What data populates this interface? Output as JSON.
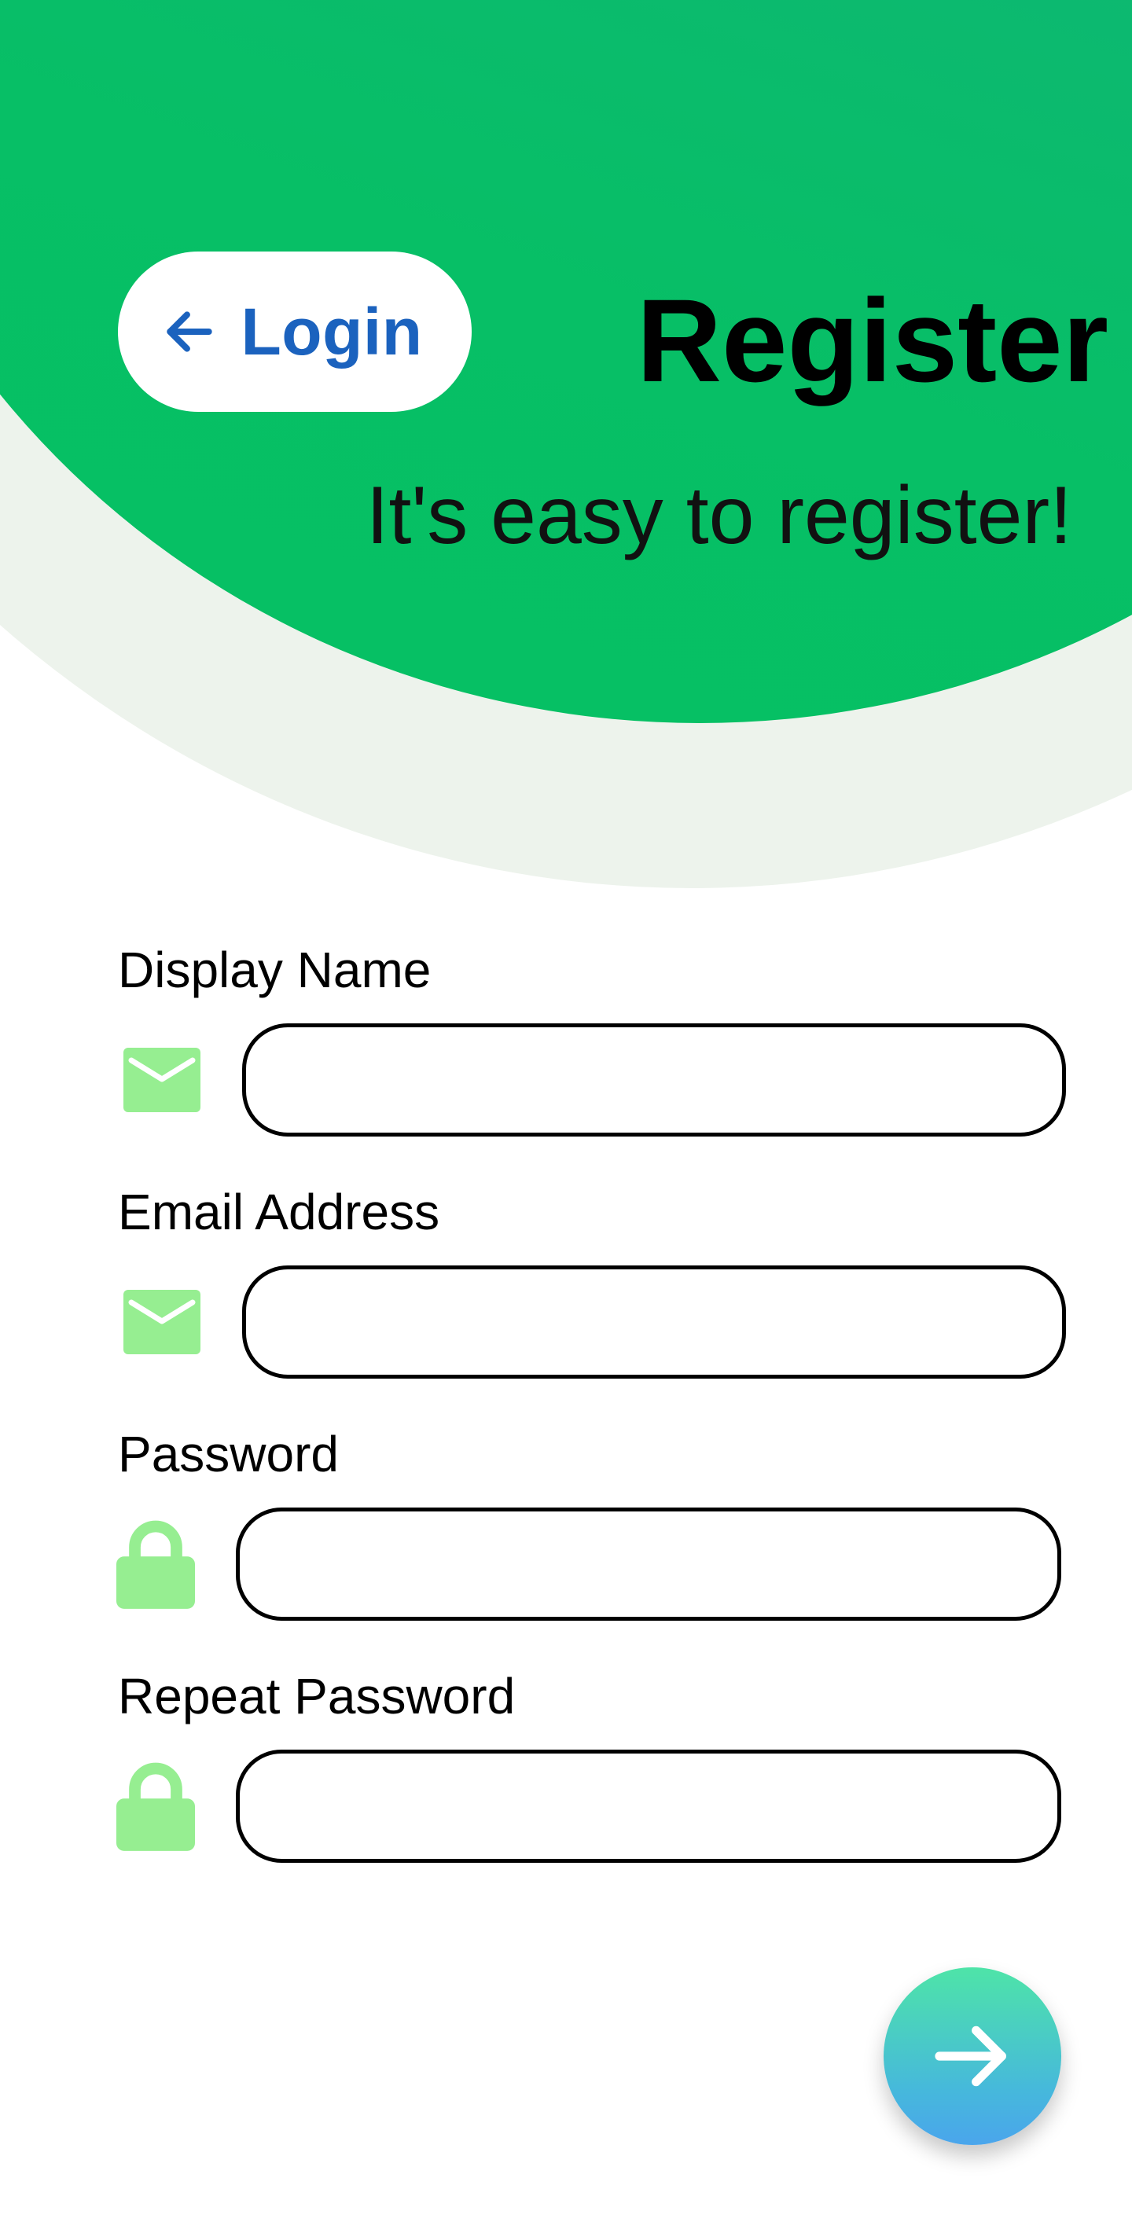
{
  "header": {
    "back_button": {
      "label": "Login",
      "icon": "arrow-left-icon"
    },
    "title": "Register",
    "subtitle": "It's easy to register!"
  },
  "form": {
    "fields": [
      {
        "label": "Display Name",
        "icon": "envelope-icon",
        "value": ""
      },
      {
        "label": "Email Address",
        "icon": "envelope-icon",
        "value": ""
      },
      {
        "label": "Password",
        "icon": "lock-icon",
        "value": ""
      },
      {
        "label": "Repeat Password",
        "icon": "lock-icon",
        "value": ""
      }
    ]
  },
  "submit_button": {
    "icon": "arrow-right-icon"
  },
  "colors": {
    "header_green": "#05c062",
    "header_teal": "#1fa283",
    "curve_light": "#edf3ec",
    "link_blue": "#1b62be",
    "icon_green": "#96ee91",
    "fab_top": "#4ee4a8",
    "fab_bottom": "#4aa5ec"
  }
}
